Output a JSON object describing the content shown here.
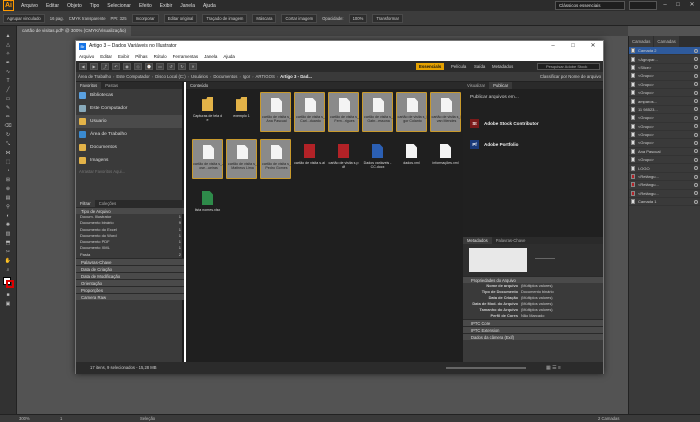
{
  "app": {
    "logo": "Ai",
    "menus": [
      "Arquivo",
      "Editar",
      "Objeto",
      "Tipo",
      "Selecionar",
      "Efeito",
      "Exibir",
      "Janela",
      "Ajuda"
    ],
    "workspace": "Clássicos essenciais"
  },
  "control": {
    "group": "Agrupar vinculado",
    "zoom_pct": "16 pag.",
    "mode": "CMYK transparente",
    "ppi": "PPI: 325",
    "incorporate": "Incorporar",
    "edit_original": "Editar original",
    "trace": "Traçado de imagem",
    "mask": "Máscara",
    "crop": "Cortar imagem",
    "opacity_label": "Opacidade:",
    "opacity": "100%",
    "transform": "Transformar"
  },
  "doc_tab": "cartão de visitas.pdf* @ 300% (CMYK/Visualização)",
  "status": {
    "zoom": "300%",
    "page": "1",
    "tool": "Seleção",
    "artboards": "2 Camadas"
  },
  "layers": {
    "tabs": [
      "Camadas",
      "Camadas"
    ],
    "items": [
      "Camada 2",
      "<Agrupar...",
      "<Slice>",
      "<Grupo>",
      "<Grupo>",
      "<Grupo>",
      "amparos...",
      "11 98523...",
      "<Grupo>",
      "<Grupo>",
      "<Grupo>",
      "<Grupo>",
      "Ana Pascual",
      "<Grupo>",
      "LOGO",
      "<Retângu...",
      "<Retângu...",
      "<Retângu...",
      "Camada 1"
    ]
  },
  "bridge": {
    "icon": "Br",
    "title": "Artigo 3 – Dados Variáveis no Illustrator",
    "menus": [
      "Arquivo",
      "Editar",
      "Exibir",
      "Pilhas",
      "Rótulo",
      "Ferramentas",
      "Janela",
      "Ajuda"
    ],
    "workspaces": [
      "Essencials",
      "Película",
      "Saída",
      "Metadados"
    ],
    "search_placeholder": "Pesquisar Adobe Stock",
    "path": [
      "Área de Trabalho",
      "Este Computador",
      "Disco Local (C:)",
      "Usuários",
      "Documentos",
      "Igor",
      "ARTIGOS",
      "Artigo 3 - Dad..."
    ],
    "sort": "Classificar por Nome de arquivo",
    "left_tabs": [
      "Favoritos",
      "Pastas"
    ],
    "favorites": [
      "Bibliotecas",
      "Este Computador",
      "Usuario",
      "Área de Trabalho",
      "Documentos",
      "Imagens",
      "Arrastar Favoritos Aqui..."
    ],
    "filter_tabs": [
      "Filtrar",
      "Coleções"
    ],
    "filter_sections": [
      "Tipo de Arquivo",
      "Palavras-Chave",
      "Data de Criação",
      "Data de Modificação",
      "Orientação",
      "Proporções",
      "Camera Raw"
    ],
    "file_types": [
      {
        "name": "Docum. Illustrator",
        "count": "1"
      },
      {
        "name": "Documento binário",
        "count": "9"
      },
      {
        "name": "Documento do Excel",
        "count": "1"
      },
      {
        "name": "Documento do Word",
        "count": "1"
      },
      {
        "name": "Documento PDF",
        "count": "1"
      },
      {
        "name": "Documento XML",
        "count": "1"
      },
      {
        "name": "Pasta",
        "count": "2"
      }
    ],
    "content_tab": "Conteúdo",
    "files": [
      {
        "name": "Capturas de tela de",
        "kind": "folder",
        "sel": false
      },
      {
        "name": "exemplo 1",
        "kind": "folder",
        "sel": false
      },
      {
        "name": "cartão de visita s_Ana Pascual",
        "kind": "doc",
        "sel": true
      },
      {
        "name": "cartão de visita s_Carl...duardo",
        "kind": "doc",
        "sel": true
      },
      {
        "name": "cartão de visita s_Fern...rigues",
        "kind": "doc",
        "sel": true
      },
      {
        "name": "cartão de visita s_Gabr...essona",
        "kind": "doc",
        "sel": true
      },
      {
        "name": "cartão de visita s_Igor Colanto",
        "kind": "doc",
        "sel": true
      },
      {
        "name": "cartão de visita s_Ivan Mendes",
        "kind": "doc",
        "sel": true
      },
      {
        "name": "cartão de visita s_Jose...ueiras",
        "kind": "doc",
        "sel": true
      },
      {
        "name": "cartão de visita s_Matheus Lima",
        "kind": "doc",
        "sel": true
      },
      {
        "name": "cartão de visita s_Pedro Gomes",
        "kind": "doc",
        "sel": true
      },
      {
        "name": "cartão de visita s.ai",
        "kind": "ai",
        "sel": false
      },
      {
        "name": "cartão de visita s.pdf",
        "kind": "pdf",
        "sel": false
      },
      {
        "name": "Dados variáveis - CC.docx",
        "kind": "word",
        "sel": false
      },
      {
        "name": "dados.xml",
        "kind": "doc",
        "sel": false
      },
      {
        "name": "informações.xml",
        "kind": "doc",
        "sel": false
      },
      {
        "name": "lista nomes.xlsx",
        "kind": "excel",
        "sel": false
      }
    ],
    "right_tabs": [
      "Visualizar",
      "Publicar"
    ],
    "publish_title": "Publicar arquivos em...",
    "publish_targets": [
      {
        "icon": "St",
        "name": "Adobe Stock Contributor",
        "color": "#7a1a1a"
      },
      {
        "icon": "Pf",
        "name": "Adobe Portfolio",
        "color": "#1a3a7a"
      }
    ],
    "meta_tabs": [
      "Metadados",
      "Palavras-Chave"
    ],
    "meta_section": "Propriedades do Arquivo",
    "meta": [
      {
        "k": "Nome de arquivo",
        "v": "(Múltiplos valores)"
      },
      {
        "k": "Tipo de Documento",
        "v": "Documento binário"
      },
      {
        "k": "Data de Criação",
        "v": "(Múltiplos valores)"
      },
      {
        "k": "Data de Mod. do Arquivo",
        "v": "(Múltiplos valores)"
      },
      {
        "k": "Tamanho do Arquivo",
        "v": "(Múltiplos valores)"
      },
      {
        "k": "Perfil de Cores",
        "v": "Não Marcado"
      }
    ],
    "meta_sections": [
      "IPTC Core",
      "IPTC Extension",
      "Dados da câmera (Exif)"
    ],
    "footer": "17 itens, 9 selecionados - 15,28 MB"
  }
}
